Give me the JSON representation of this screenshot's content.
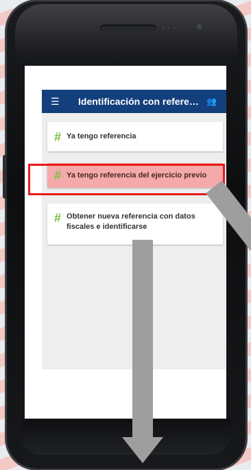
{
  "appbar": {
    "title": "Identificación con refere…",
    "menu_icon": "menu-icon",
    "people_icon": "people-icon"
  },
  "cards": [
    {
      "hash": "#",
      "label": "Ya tengo referencia"
    },
    {
      "hash": "#",
      "label": "Ya tengo referencia  del ejercicio previo"
    },
    {
      "hash": "#",
      "label": "Obtener nueva referencia con datos fiscales e identificarse"
    }
  ],
  "colors": {
    "appbar": "#133f7c",
    "hash": "#7ac142",
    "highlight_border": "#ea1a1a",
    "highlight_fill": "#f4aaaa",
    "arrow": "#9e9e9e"
  }
}
